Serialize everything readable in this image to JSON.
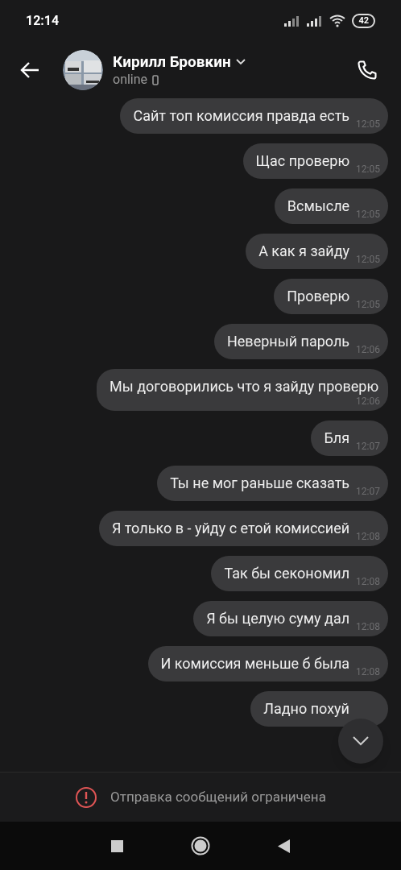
{
  "status_bar": {
    "time": "12:14",
    "battery": "42"
  },
  "header": {
    "name": "Кирилл Бровкин",
    "status": "online"
  },
  "messages": [
    {
      "text": "Сайт топ комиссия правда есть",
      "time": "12:05"
    },
    {
      "text": "Щас проверю",
      "time": "12:05"
    },
    {
      "text": "Всмысле",
      "time": "12:05"
    },
    {
      "text": "А как я зайду",
      "time": "12:05"
    },
    {
      "text": "Проверю",
      "time": "12:05"
    },
    {
      "text": "Неверный пароль",
      "time": "12:06"
    },
    {
      "text": "Мы договорились что я зайду проверю",
      "time": "12:06"
    },
    {
      "text": "Бля",
      "time": "12:07"
    },
    {
      "text": "Ты не мог раньше сказать",
      "time": "12:07"
    },
    {
      "text": "Я только в - уйду с етой комиссией",
      "time": "12:08"
    },
    {
      "text": "Так бы секономил",
      "time": "12:08"
    },
    {
      "text": "Я бы целую суму дал",
      "time": "12:08"
    },
    {
      "text": "И комиссия меньше б была",
      "time": "12:08"
    },
    {
      "text": "Ладно похуй"
    }
  ],
  "restriction_notice": "Отправка сообщений ограничена"
}
